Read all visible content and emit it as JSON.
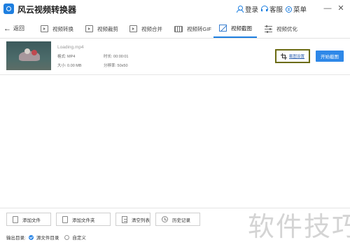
{
  "titlebar": {
    "app_title": "风云视频转换器",
    "login": "登录",
    "service": "客服",
    "menu": "菜单",
    "minimize": "—",
    "close": "✕"
  },
  "navbar": {
    "back": "返回",
    "tabs": [
      {
        "label": "视频转换",
        "icon": "video-convert-icon",
        "active": false
      },
      {
        "label": "视频裁剪",
        "icon": "video-cut-icon",
        "active": false
      },
      {
        "label": "视频合并",
        "icon": "video-merge-icon",
        "active": false
      },
      {
        "label": "视频转GIF",
        "icon": "gif-icon",
        "active": false
      },
      {
        "label": "视频截图",
        "icon": "screenshot-icon",
        "active": true
      },
      {
        "label": "视频优化",
        "icon": "optimize-icon",
        "active": false
      }
    ]
  },
  "file": {
    "name": "Loading.mp4",
    "format_label": "格式: MP4",
    "duration_label": "时长: 00:00:01",
    "size_label": "大小: 0.00 MB",
    "resolution_label": "分辨率: 50x50",
    "crop_settings": "截图设置",
    "start": "开始截图"
  },
  "bottom": {
    "add_file": "添加文件",
    "add_folder": "添加文件夹",
    "clear_list": "清空列表",
    "history": "历史记录",
    "output_label": "输出目录:",
    "source_dir": "源文件目录",
    "custom": "自定义"
  },
  "watermark": "软件技巧",
  "colors": {
    "accent": "#2e88e8",
    "highlight_border": "#6b6b12"
  }
}
